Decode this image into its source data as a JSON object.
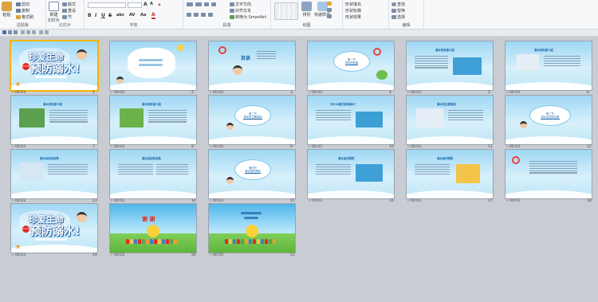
{
  "ribbon": {
    "clipboard": {
      "paste": "粘贴",
      "cut": "剪切",
      "copy": "复制",
      "format_painter": "格式刷",
      "group": "剪贴板"
    },
    "slides": {
      "new_slide": "新建\n幻灯片",
      "layout": "版式",
      "reset": "重设",
      "section": "节",
      "group": "幻灯片"
    },
    "font": {
      "group": "字体",
      "font_size": "",
      "bold": "B",
      "italic": "I",
      "underline": "U",
      "strike": "S",
      "shadow": "abc",
      "spacing": "AV",
      "case": "Aa",
      "color": "A"
    },
    "paragraph": {
      "group": "段落",
      "text_direction": "文字方向",
      "align_text": "对齐文本",
      "smartart": "转换为 SmartArt"
    },
    "drawing": {
      "group": "绘图",
      "arrange": "排列",
      "quick_styles": "快速样式",
      "shape_fill": "形状填充",
      "shape_outline": "形状轮廓",
      "shape_effects": "形状效果"
    },
    "editing": {
      "group": "编辑",
      "find": "查找",
      "replace": "替换",
      "select": "选择"
    }
  },
  "slides": [
    {
      "num": "1",
      "time": "00:03",
      "title1": "珍爱生命",
      "title2": "预防溺水!",
      "badge": "STOP"
    },
    {
      "num": "2",
      "time": "00:03"
    },
    {
      "num": "3",
      "time": "00:03",
      "heading": "目录"
    },
    {
      "num": "4",
      "time": "00:03",
      "line1": "第一节",
      "line2": "溺水的危害"
    },
    {
      "num": "5",
      "time": "00:03",
      "heading": "溺水的危害介绍"
    },
    {
      "num": "6",
      "time": "00:03",
      "heading": "溺水的危害介绍"
    },
    {
      "num": "7",
      "time": "00:03",
      "heading": "溺水的危害介绍"
    },
    {
      "num": "8",
      "time": "00:03",
      "heading": "溺水的危害介绍"
    },
    {
      "num": "9",
      "time": "00:03",
      "line1": "第二节",
      "line2": "溺水的主要原因"
    },
    {
      "num": "10",
      "time": "00:03",
      "heading": "为什么我们容易溺水？"
    },
    {
      "num": "11",
      "time": "00:03",
      "heading": "溺水的主要原因"
    },
    {
      "num": "12",
      "time": "00:03",
      "line1": "第三节",
      "line2": "溺水后如何自救"
    },
    {
      "num": "13",
      "time": "00:03",
      "heading": "溺水后如何自救"
    },
    {
      "num": "14",
      "time": "00:03",
      "heading": "溺水后如何自救"
    },
    {
      "num": "15",
      "time": "00:03",
      "line1": "第四节",
      "line2": "溺水如何预防"
    },
    {
      "num": "16",
      "time": "00:03",
      "heading": "溺水如何预防"
    },
    {
      "num": "17",
      "time": "00:03",
      "heading": "溺水如何预防"
    },
    {
      "num": "18",
      "time": "00:03"
    },
    {
      "num": "19",
      "time": "00:03",
      "title1": "珍爱生命",
      "title2": "预防溺水!",
      "badge": "STOP"
    },
    {
      "num": "20",
      "time": "00:03",
      "heading": "谢 谢"
    },
    {
      "num": "21",
      "time": "00:03"
    }
  ],
  "colors": {
    "sky": "#9fd7f4",
    "accent_red": "#e3281f",
    "title_blue": "#1a5fa8",
    "selected": "#f4b400"
  }
}
